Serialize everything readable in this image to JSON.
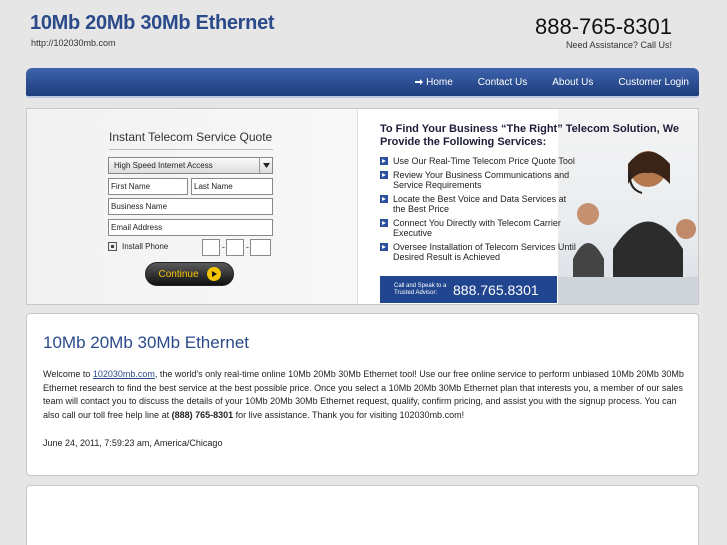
{
  "header": {
    "title": "10Mb 20Mb 30Mb Ethernet",
    "url": "http://102030mb.com",
    "phone": "888-765-8301",
    "assist": "Need Assistance? Call Us!"
  },
  "nav": {
    "items": [
      {
        "label": "Home"
      },
      {
        "label": "Contact Us"
      },
      {
        "label": "About Us"
      },
      {
        "label": "Customer Login"
      }
    ]
  },
  "quote": {
    "title": "Instant Telecom Service Quote",
    "service_select": "High Speed Internet Access",
    "first_name": "First Name",
    "last_name": "Last Name",
    "business_name": "Business Name",
    "email": "Email Address",
    "install_phone": "Install Phone",
    "phone_dash": "-",
    "continue": "Continue"
  },
  "promo": {
    "heading": "To Find Your Business “The Right” Telecom Solution, We Provide the Following Services:",
    "items": [
      "Use Our Real-Time Telecom Price Quote Tool",
      "Review Your Business Communications and Service Requirements",
      "Locate the Best Voice and Data Services at the Best Price",
      "Connect You Directly with Telecom Carrier Executive",
      "Oversee Installation of Telecom Services Until Desired Result is Achieved"
    ],
    "call_text": "Call and Speak to a Trusted Advisor:",
    "call_phone": "888.765.8301"
  },
  "content": {
    "title": "10Mb 20Mb 30Mb Ethernet",
    "welcome": "Welcome to ",
    "link": "102030mb.com",
    "body1": ", the world's only real-time online 10Mb 20Mb 30Mb Ethernet tool! Use our free online service to perform unbiased 10Mb 20Mb 30Mb Ethernet research to find the best service at the best possible price. Once you select a 10Mb 20Mb 30Mb Ethernet plan that interests you, a member of our sales team will contact you to discuss the details of your 10Mb 20Mb 30Mb Ethernet request, qualify, confirm pricing, and assist you with the signup process. You can also call our toll free help line at ",
    "phone_bold": "(888) 765-8301",
    "body2": " for live assistance. Thank you for visiting 102030mb.com!",
    "timestamp": "June 24, 2011, 7:59:23 am, America/Chicago"
  },
  "colors": {
    "brand_blue": "#2b4a8a",
    "nav_blue": "#1d3c7b",
    "button_yellow": "#f5c400"
  }
}
